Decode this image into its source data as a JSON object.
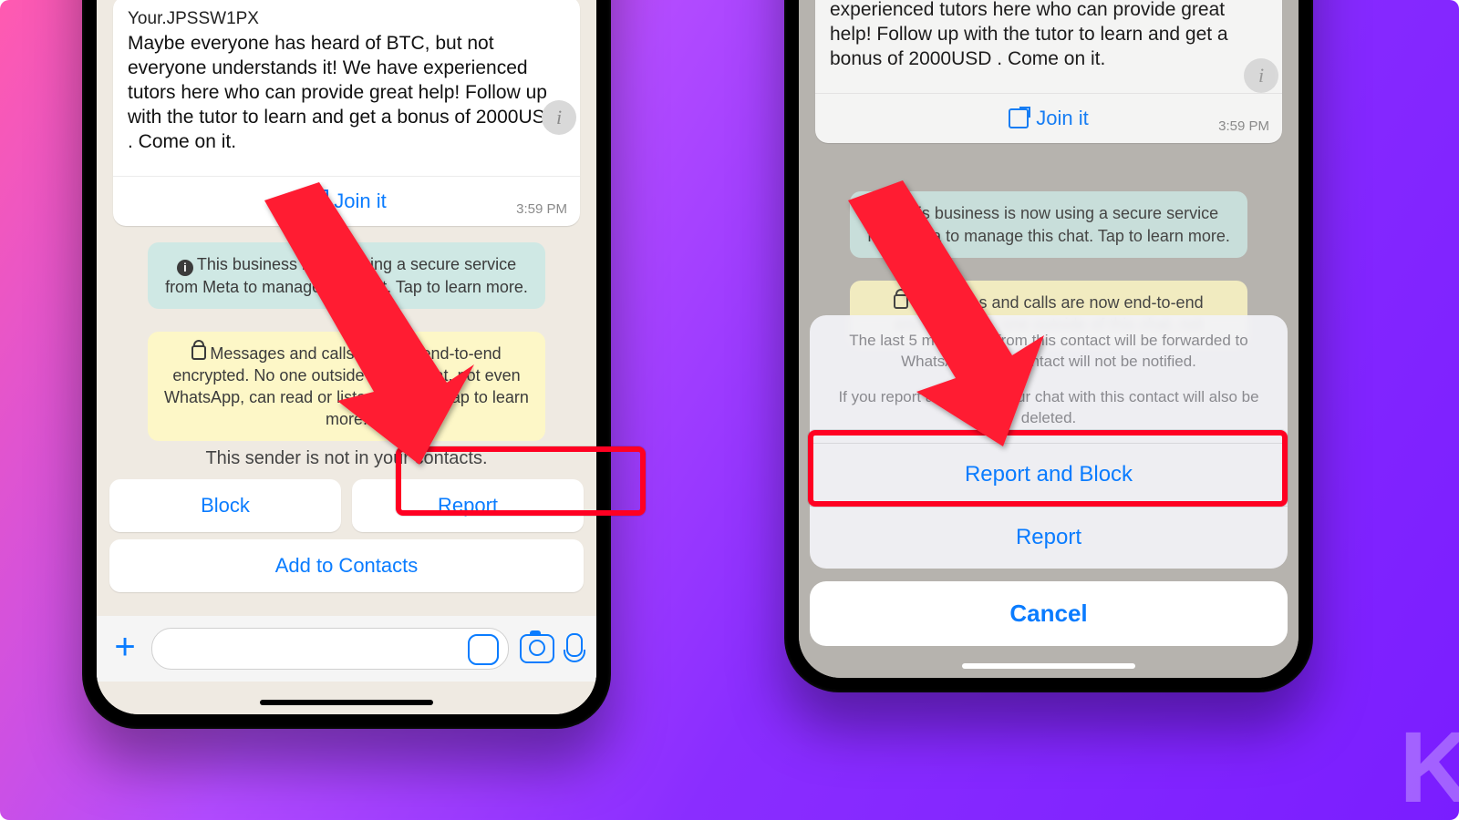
{
  "left": {
    "message": {
      "code_line": "Your.JPSSW1PX",
      "body": "Maybe everyone has heard of BTC, but not everyone understands it! We have experienced tutors here who can provide great help! Follow up with the tutor to learn and get a bonus of 2000USD . Come on it.",
      "time": "3:59 PM",
      "join": "Join it"
    },
    "sys_secure": "This business is now using a secure service from Meta to manage this chat. Tap to learn more.",
    "sys_e2e": "Messages and calls are now end-to-end encrypted. No one outside of this chat, not even WhatsApp, can read or listen to them. Tap to learn more.",
    "not_in_contacts": "This sender is not in your contacts.",
    "block": "Block",
    "report": "Report",
    "add": "Add to Contacts"
  },
  "right": {
    "message": {
      "body": "but not everyone understands it! We have experienced tutors here who can provide great help! Follow up with the tutor to learn and get a bonus of 2000USD . Come on it.",
      "time": "3:59 PM",
      "join": "Join it"
    },
    "sys_secure": "This business is now using a secure service from Meta to manage this chat. Tap to learn more.",
    "sys_e2e": "Messages and calls are now end-to-end encrypted. No one outside of this chat, not",
    "sheet": {
      "line1": "The last 5 messages from this contact will be forwarded to WhatsApp. This contact will not be notified.",
      "line2": "If you report and block, your chat with this contact will also be deleted.",
      "report_block": "Report and Block",
      "report": "Report",
      "cancel": "Cancel"
    }
  },
  "watermark": "K"
}
